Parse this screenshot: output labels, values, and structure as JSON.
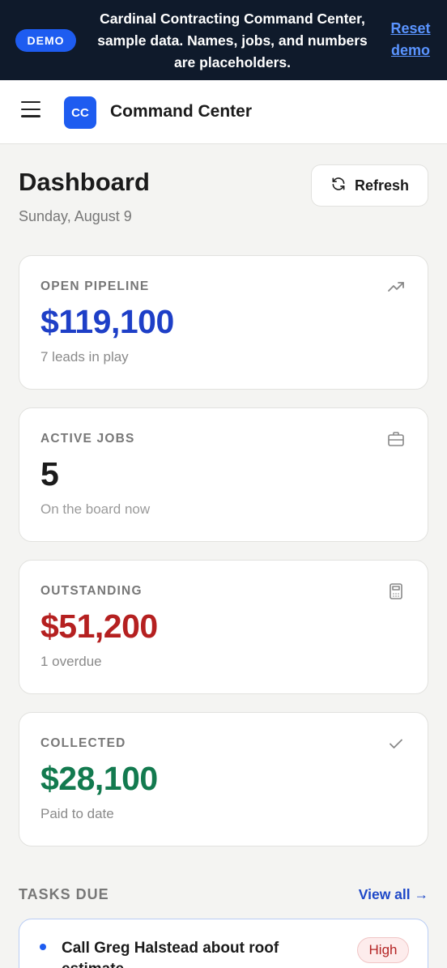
{
  "banner": {
    "badge": "DEMO",
    "text": "Cardinal Contracting Command Center, sample data. Names, jobs, and numbers are placeholders.",
    "reset_link": "Reset demo"
  },
  "topbar": {
    "logo_text": "CC",
    "app_title": "Command Center"
  },
  "page": {
    "title": "Dashboard",
    "date": "Sunday, August 9",
    "refresh_label": "Refresh"
  },
  "cards": [
    {
      "label": "OPEN PIPELINE",
      "value": "$119,100",
      "sub": "7 leads in play",
      "icon": "trending-up-icon",
      "color": "#1e3fc7"
    },
    {
      "label": "ACTIVE JOBS",
      "value": "5",
      "sub": "On the board now",
      "icon": "briefcase-icon",
      "color": "#1b1b1b"
    },
    {
      "label": "OUTSTANDING",
      "value": "$51,200",
      "sub": "1 overdue",
      "icon": "calculator-icon",
      "color": "#b52020"
    },
    {
      "label": "COLLECTED",
      "value": "$28,100",
      "sub": "Paid to date",
      "icon": "check-icon",
      "color": "#137a4f"
    }
  ],
  "tasks": {
    "header": "TASKS DUE",
    "view_all": "View all →",
    "items": [
      {
        "title": "Call Greg Halstead about roof estimate",
        "priority": "High"
      }
    ]
  }
}
